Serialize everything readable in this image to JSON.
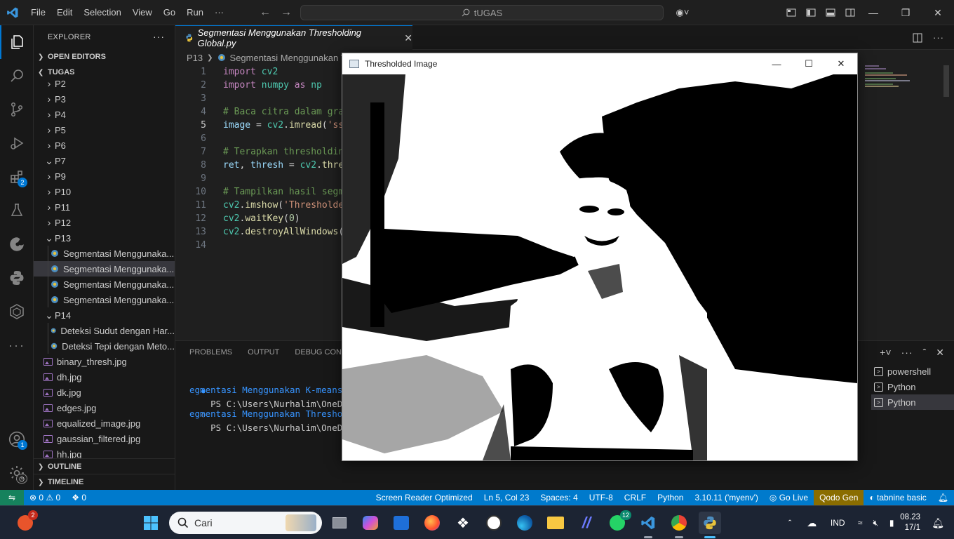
{
  "titlebar": {
    "menu": [
      "File",
      "Edit",
      "Selection",
      "View",
      "Go",
      "Run",
      "···"
    ],
    "search": "tUGAS"
  },
  "activity": {
    "extensions_badge": "2",
    "accounts_badge": "1"
  },
  "sidebar": {
    "title": "EXPLORER",
    "open_editors": "OPEN EDITORS",
    "folder": "TUGAS",
    "items": [
      {
        "label": "P2",
        "type": "folder-closed"
      },
      {
        "label": "P3",
        "type": "folder-closed"
      },
      {
        "label": "P4",
        "type": "folder-closed"
      },
      {
        "label": "P5",
        "type": "folder-closed"
      },
      {
        "label": "P6",
        "type": "folder-closed"
      },
      {
        "label": "P7",
        "type": "folder-open"
      },
      {
        "label": "P9",
        "type": "folder-closed"
      },
      {
        "label": "P10",
        "type": "folder-closed"
      },
      {
        "label": "P11",
        "type": "folder-closed"
      },
      {
        "label": "P12",
        "type": "folder-closed"
      },
      {
        "label": "P13",
        "type": "folder-open"
      },
      {
        "label": "Segmentasi Menggunaka...",
        "type": "py"
      },
      {
        "label": "Segmentasi Menggunaka...",
        "type": "py",
        "selected": true
      },
      {
        "label": "Segmentasi Menggunaka...",
        "type": "py"
      },
      {
        "label": "Segmentasi Menggunaka...",
        "type": "py"
      },
      {
        "label": "P14",
        "type": "folder-open"
      },
      {
        "label": "Deteksi Sudut dengan Har...",
        "type": "py"
      },
      {
        "label": "Deteksi Tepi dengan Meto...",
        "type": "py"
      },
      {
        "label": "binary_thresh.jpg",
        "type": "img"
      },
      {
        "label": "dh.jpg",
        "type": "img"
      },
      {
        "label": "dk.jpg",
        "type": "img"
      },
      {
        "label": "edges.jpg",
        "type": "img"
      },
      {
        "label": "equalized_image.jpg",
        "type": "img"
      },
      {
        "label": "gaussian_filtered.jpg",
        "type": "img"
      },
      {
        "label": "hh.jpg",
        "type": "img"
      }
    ],
    "outline": "OUTLINE",
    "timeline": "TIMELINE"
  },
  "editor": {
    "tab_label": "Segmentasi Menggunakan Thresholding Global.py",
    "breadcrumb_folder": "P13",
    "breadcrumb_file": "Segmentasi Menggunakan T",
    "line_numbers": [
      "1",
      "2",
      "3",
      "4",
      "5",
      "6",
      "7",
      "8",
      "9",
      "10",
      "11",
      "12",
      "13",
      "14"
    ],
    "code": {
      "l1_kw": "import",
      "l1_mod": " cv2",
      "l2_kw": "import",
      "l2_mod": " numpy ",
      "l2_as": "as",
      "l2_np": " np",
      "l4": "# Baca citra dalam gra",
      "l5_a": "image",
      "l5_b": " = ",
      "l5_c": "cv2",
      "l5_d": ".",
      "l5_e": "imread",
      "l5_f": "(",
      "l5_g": "'ss",
      "l7": "# Terapkan thresholdin",
      "l8_a": "ret",
      "l8_b": ", ",
      "l8_c": "thresh",
      "l8_d": " = ",
      "l8_e": "cv2",
      "l8_f": ".",
      "l8_g": "thre",
      "l10": "# Tampilkan hasil segm",
      "l11_a": "cv2",
      "l11_b": ".",
      "l11_c": "imshow",
      "l11_d": "(",
      "l11_e": "'Thresholde",
      "l12_a": "cv2",
      "l12_b": ".",
      "l12_c": "waitKey",
      "l12_d": "(",
      "l12_e": "0",
      "l12_f": ")",
      "l13_a": "cv2",
      "l13_b": ".",
      "l13_c": "destroyAllWindows",
      "l13_d": "("
    }
  },
  "panel": {
    "tabs": [
      "PROBLEMS",
      "OUTPUT",
      "DEBUG CONSO"
    ],
    "terminal": [
      "PS C:\\Users\\Nurhalim\\OneDrive\\t",
      "egmentasi Menggunakan K-means C",
      "PS C:\\Users\\Nurhalim\\OneDrive\\t",
      "egmentasi Menggunakan Threshold"
    ],
    "terminals": [
      "powershell",
      "Python",
      "Python"
    ]
  },
  "image_window": {
    "title": "Thresholded Image"
  },
  "statusbar": {
    "errors": "0",
    "warnings": "0",
    "ports": "0",
    "items": [
      "Screen Reader Optimized",
      "Ln 5, Col 23",
      "Spaces: 4",
      "UTF-8",
      "CRLF",
      "Python",
      "3.10.11 ('myenv')",
      "Go Live",
      "Qodo Gen",
      "tabnine basic"
    ]
  },
  "taskbar": {
    "search_placeholder": "Cari",
    "start_badge": "2",
    "whatsapp_badge": "12",
    "language": "IND",
    "time": "08.23",
    "date": "17/1"
  }
}
